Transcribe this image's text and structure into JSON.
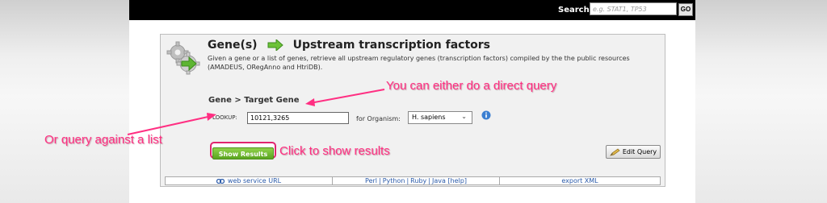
{
  "header": {
    "search_label": "Search:",
    "search_placeholder": "e.g. STAT1, TP53",
    "go_label": "GO"
  },
  "panel": {
    "title_left": "Gene(s)",
    "title_right": "Upstream transcription factors",
    "description": "Given a gene or a list of genes, retrieve all upstream regulatory genes (transcription factors) compiled by the the public resources (AMADEUS, ORegAnno and HtriDB).",
    "section_heading": "Gene > Target Gene",
    "lookup_label": "LOOKUP:",
    "lookup_value": "10121,3265",
    "organism_label": "for Organism:",
    "organism_value": "H. sapiens",
    "show_results_label": "Show Results",
    "edit_query_label": "Edit Query"
  },
  "footer": {
    "web_service": "web service URL",
    "perl": "Perl",
    "python": "Python",
    "ruby": "Ruby",
    "java": "Java [help]",
    "export": "export XML",
    "separator": "|"
  },
  "annotations": {
    "direct_query": "You can either do a direct query",
    "list_query": "Or query against a list",
    "click_results": "Click to show results"
  },
  "colors": {
    "annotation": "#ff2f82",
    "button_green": "#6cb52e",
    "link_blue": "#2a5aa9"
  },
  "icons": {
    "panel_icon": "gear-icon",
    "title_arrow": "arrow-right-icon",
    "info": "info-icon",
    "edit": "pencil-icon",
    "web_service": "link-icon",
    "organism_dropdown": "chevron-down-icon"
  }
}
